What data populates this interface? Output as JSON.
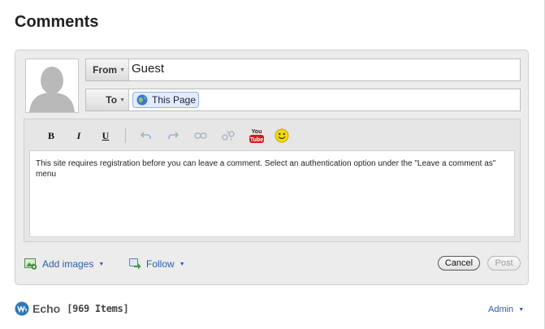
{
  "page": {
    "title": "Comments"
  },
  "composer": {
    "from_label": "From",
    "from_value": "Guest",
    "to_label": "To",
    "to_value": "This Page",
    "toolbar": {
      "bold": "B",
      "italic": "I",
      "underline": "U",
      "icons": [
        "undo-icon",
        "redo-icon",
        "link-icon",
        "unlink-icon",
        "youtube-icon",
        "smiley-icon"
      ],
      "youtube_text": "You\nTube"
    },
    "message": "This site requires registration before you can leave a comment. Select an authentication option under the \"Leave a comment as\" menu",
    "add_images_label": "Add images",
    "follow_label": "Follow",
    "cancel_label": "Cancel",
    "post_label": "Post"
  },
  "footer": {
    "brand": "Echo",
    "count": "[969 Items]",
    "admin_label": "Admin"
  },
  "colors": {
    "link": "#2a5db0",
    "panel": "#ececec",
    "to_chip": "#e3ecfb"
  }
}
